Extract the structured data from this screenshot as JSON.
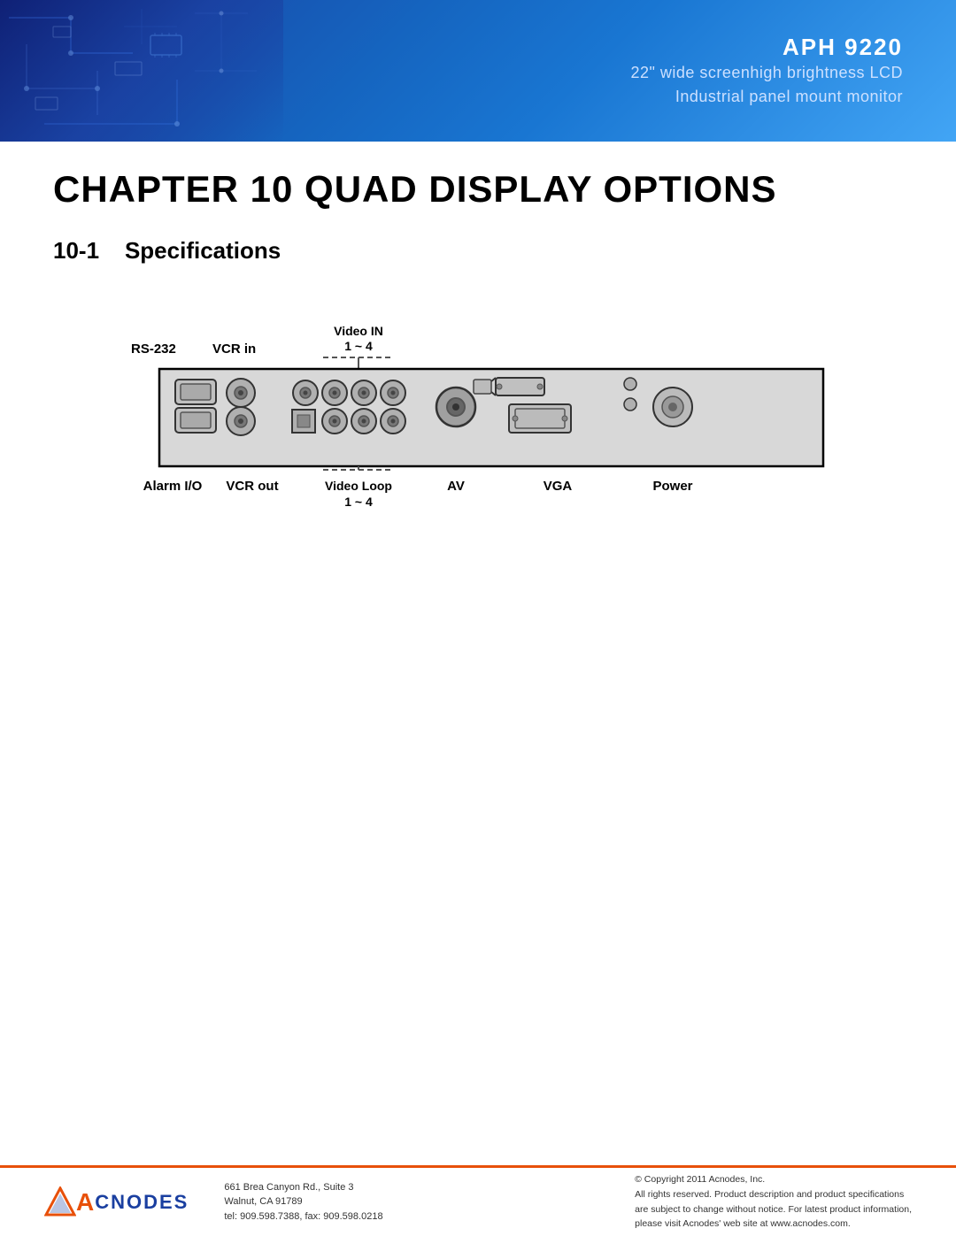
{
  "header": {
    "model": "APH 9220",
    "line1": "22\" wide screenhigh brightness LCD",
    "line2": "Industrial panel mount monitor"
  },
  "chapter": {
    "title": "CHAPTER 10 QUAD DISPLAY OPTIONS",
    "section_number": "10-1",
    "section_title": "Specifications"
  },
  "diagram": {
    "labels_top": {
      "rs232": "RS-232",
      "vcr_in": "VCR in",
      "video_in": "Video IN",
      "video_in_range": "1 ~ 4"
    },
    "labels_bottom": {
      "alarm": "Alarm I/O",
      "vcr_out": "VCR out",
      "video_loop": "Video Loop",
      "video_loop_range": "1 ~ 4",
      "av": "AV",
      "vga": "VGA",
      "power": "Power"
    }
  },
  "footer": {
    "logo_a": "A",
    "logo_rest": "CNODES",
    "address_line1": "661 Brea Canyon Rd., Suite 3",
    "address_line2": "Walnut, CA 91789",
    "address_line3": "tel: 909.598.7388, fax: 909.598.0218",
    "copyright_line1": "© Copyright 2011 Acnodes, Inc.",
    "copyright_line2": "All rights reserved. Product description and product specifications",
    "copyright_line3": "are subject to change without notice. For latest product information,",
    "copyright_line4": "please visit Acnodes' web site at www.acnodes.com."
  }
}
